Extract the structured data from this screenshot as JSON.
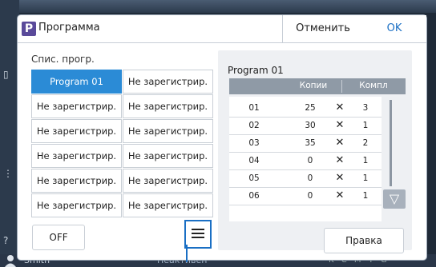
{
  "dialog": {
    "icon": "P",
    "title": "Программа",
    "cancel_label": "Отменить",
    "ok_label": "OK"
  },
  "program_list": {
    "label": "Спис. прогр.",
    "items": [
      {
        "label": "Program 01",
        "selected": true
      },
      {
        "label": "Не зарегистрир."
      },
      {
        "label": "Не зарегистрир."
      },
      {
        "label": "Не зарегистрир."
      },
      {
        "label": "Не зарегистрир."
      },
      {
        "label": "Не зарегистрир."
      },
      {
        "label": "Не зарегистрир."
      },
      {
        "label": "Не зарегистрир."
      },
      {
        "label": "Не зарегистрир."
      },
      {
        "label": "Не зарегистрир."
      },
      {
        "label": "Не зарегистрир."
      },
      {
        "label": "Не зарегистрир."
      }
    ]
  },
  "controls": {
    "off_label": "OFF",
    "menu_icon": "hamburger-menu-icon"
  },
  "detail": {
    "title": "Program 01",
    "columns": [
      "Копии",
      "Компл"
    ],
    "rows": [
      {
        "no": "01",
        "copies": "25",
        "sets": "3"
      },
      {
        "no": "02",
        "copies": "30",
        "sets": "1"
      },
      {
        "no": "03",
        "copies": "35",
        "sets": "2"
      },
      {
        "no": "04",
        "copies": "0",
        "sets": "1"
      },
      {
        "no": "05",
        "copies": "0",
        "sets": "1"
      },
      {
        "no": "06",
        "copies": "0",
        "sets": "1"
      }
    ],
    "multiply_symbol": "✕",
    "edit_label": "Правка"
  },
  "statusbar": {
    "user": "Smith",
    "state": "Неактивен",
    "cmyk": [
      "K",
      "C",
      "M",
      "Y",
      "G"
    ]
  },
  "colors": {
    "accent": "#1a6fc4",
    "selected": "#2b8bd6",
    "title_icon": "#5a4a9a"
  }
}
